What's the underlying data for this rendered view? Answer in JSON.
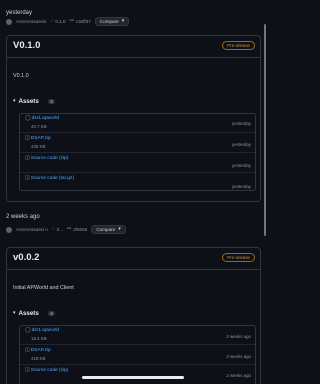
{
  "release1": {
    "date": "yesterday",
    "author": "ArsonAssassin",
    "tag": "0.1.0",
    "commit": "c3eff37",
    "compare": "Compare",
    "title": "V0.1.0",
    "badge": "Pre-release",
    "notes": "V0.1.0",
    "assets_label": "Assets",
    "assets_count": "4",
    "assets": [
      {
        "name": "dsr1.apworld",
        "size": "40.7 KB",
        "date": "yesterday"
      },
      {
        "name": "DSAP.zip",
        "size": "435 KB",
        "date": "yesterday"
      },
      {
        "name": "Source code (zip)",
        "size": "",
        "date": "yesterday"
      },
      {
        "name": "Source code (tar.gz)",
        "size": "",
        "date": "yesterday"
      }
    ]
  },
  "release2": {
    "date": "2 weeks ago",
    "author": "ArsonAssassi n",
    "tag": "0...",
    "commit": "2f5056",
    "compare": "Compare",
    "title": "v0.0.2",
    "badge": "Pre-release",
    "notes": "Initial APWorld and Client",
    "assets_label": "Assets",
    "assets_count": "4",
    "assets": [
      {
        "name": "dsr1.apworld",
        "size": "18.4 KB",
        "date": "2 weeks ago"
      },
      {
        "name": "DSAP.zip",
        "size": "418 KB",
        "date": "2 weeks ago"
      },
      {
        "name": "Source code (zip)",
        "size": "",
        "date": "2 weeks ago"
      }
    ]
  },
  "icons": {
    "tag": "tag-icon",
    "commit": "commit-icon",
    "package": "package-icon",
    "zip": "file-zip-icon",
    "chevron": "chevron-down-icon",
    "triangle": "triangle-down-icon"
  }
}
